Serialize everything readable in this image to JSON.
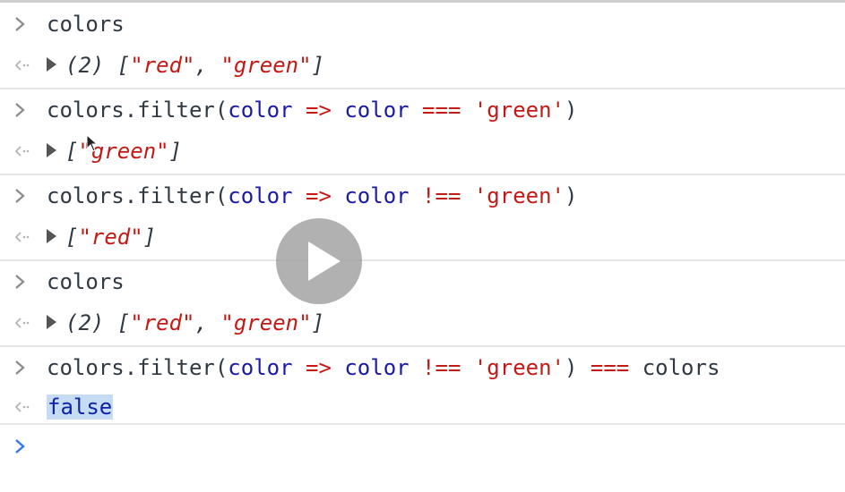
{
  "console": {
    "entries": [
      {
        "input": [
          {
            "t": "colors",
            "c": "punc"
          }
        ],
        "output": [
          {
            "t": "(2) [",
            "c": "punc"
          },
          {
            "t": "\"red\"",
            "c": "str"
          },
          {
            "t": ", ",
            "c": "punc"
          },
          {
            "t": "\"green\"",
            "c": "str"
          },
          {
            "t": "]",
            "c": "punc"
          }
        ],
        "expandable": true
      },
      {
        "input": [
          {
            "t": "colors.filter(",
            "c": "punc"
          },
          {
            "t": "color",
            "c": "kw"
          },
          {
            "t": " => ",
            "c": "str"
          },
          {
            "t": "color",
            "c": "kw"
          },
          {
            "t": " === ",
            "c": "str"
          },
          {
            "t": "'green'",
            "c": "str"
          },
          {
            "t": ")",
            "c": "punc"
          }
        ],
        "output": [
          {
            "t": "[",
            "c": "punc"
          },
          {
            "t": "\"green\"",
            "c": "str"
          },
          {
            "t": "]",
            "c": "punc"
          }
        ],
        "expandable": true
      },
      {
        "input": [
          {
            "t": "colors.filter(",
            "c": "punc"
          },
          {
            "t": "color",
            "c": "kw"
          },
          {
            "t": " => ",
            "c": "str"
          },
          {
            "t": "color",
            "c": "kw"
          },
          {
            "t": " !== ",
            "c": "str"
          },
          {
            "t": "'green'",
            "c": "str"
          },
          {
            "t": ")",
            "c": "punc"
          }
        ],
        "output": [
          {
            "t": "[",
            "c": "punc"
          },
          {
            "t": "\"red\"",
            "c": "str"
          },
          {
            "t": "]",
            "c": "punc"
          }
        ],
        "expandable": true
      },
      {
        "input": [
          {
            "t": "colors",
            "c": "punc"
          }
        ],
        "output": [
          {
            "t": "(2) [",
            "c": "punc"
          },
          {
            "t": "\"red\"",
            "c": "str"
          },
          {
            "t": ", ",
            "c": "punc"
          },
          {
            "t": "\"green\"",
            "c": "str"
          },
          {
            "t": "]",
            "c": "punc"
          }
        ],
        "expandable": true
      },
      {
        "input": [
          {
            "t": "colors.filter(",
            "c": "punc"
          },
          {
            "t": "color",
            "c": "kw"
          },
          {
            "t": " => ",
            "c": "str"
          },
          {
            "t": "color",
            "c": "kw"
          },
          {
            "t": " !== ",
            "c": "str"
          },
          {
            "t": "'green'",
            "c": "str"
          },
          {
            "t": ")",
            "c": "punc"
          },
          {
            "t": " === ",
            "c": "str"
          },
          {
            "t": "colors",
            "c": "punc"
          }
        ],
        "output": [
          {
            "t": "false",
            "c": "bool"
          }
        ],
        "expandable": false
      }
    ]
  },
  "icons": {
    "input_prompt": "chevron-right-icon",
    "output_marker": "return-arrow-icon",
    "expand": "expand-triangle-icon",
    "play": "play-icon",
    "cursor": "mouse-pointer-icon"
  },
  "colors": {
    "string": "#c41a16",
    "keyword": "#1a1aa6",
    "text": "#303942",
    "prompt_active": "#2f7ae5",
    "selection": "#c6dcf5"
  }
}
